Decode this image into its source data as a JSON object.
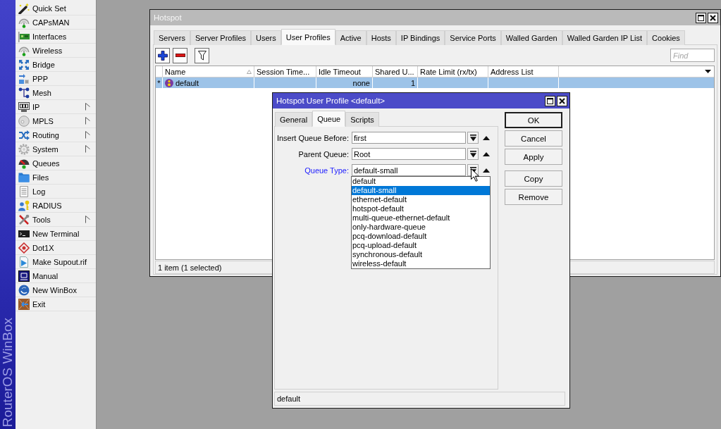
{
  "sidebar": {
    "brand": "RouterOS WinBox",
    "items": [
      {
        "label": "Quick Set",
        "submenu": false
      },
      {
        "label": "CAPsMAN",
        "submenu": false
      },
      {
        "label": "Interfaces",
        "submenu": false
      },
      {
        "label": "Wireless",
        "submenu": false
      },
      {
        "label": "Bridge",
        "submenu": false
      },
      {
        "label": "PPP",
        "submenu": false
      },
      {
        "label": "Mesh",
        "submenu": false
      },
      {
        "label": "IP",
        "submenu": true
      },
      {
        "label": "MPLS",
        "submenu": true
      },
      {
        "label": "Routing",
        "submenu": true
      },
      {
        "label": "System",
        "submenu": true
      },
      {
        "label": "Queues",
        "submenu": false
      },
      {
        "label": "Files",
        "submenu": false
      },
      {
        "label": "Log",
        "submenu": false
      },
      {
        "label": "RADIUS",
        "submenu": false
      },
      {
        "label": "Tools",
        "submenu": true
      },
      {
        "label": "New Terminal",
        "submenu": false
      },
      {
        "label": "Dot1X",
        "submenu": false
      },
      {
        "label": "Make Supout.rif",
        "submenu": false
      },
      {
        "label": "Manual",
        "submenu": false
      },
      {
        "label": "New WinBox",
        "submenu": false
      },
      {
        "label": "Exit",
        "submenu": false
      }
    ]
  },
  "hotspot_window": {
    "title": "Hotspot",
    "active": false,
    "tabs": [
      {
        "label": "Servers",
        "selected": false
      },
      {
        "label": "Server Profiles",
        "selected": false
      },
      {
        "label": "Users",
        "selected": false
      },
      {
        "label": "User Profiles",
        "selected": true
      },
      {
        "label": "Active",
        "selected": false
      },
      {
        "label": "Hosts",
        "selected": false
      },
      {
        "label": "IP Bindings",
        "selected": false
      },
      {
        "label": "Service Ports",
        "selected": false
      },
      {
        "label": "Walled Garden",
        "selected": false
      },
      {
        "label": "Walled Garden IP List",
        "selected": false
      },
      {
        "label": "Cookies",
        "selected": false
      }
    ],
    "find": {
      "placeholder": "Find"
    },
    "table": {
      "columns": [
        {
          "label": "Name",
          "kind": "text",
          "sorted": true
        },
        {
          "label": "Session Time...",
          "kind": "text",
          "sorted": false
        },
        {
          "label": "Idle Timeout",
          "kind": "numeric",
          "sorted": false
        },
        {
          "label": "Shared U...",
          "kind": "numeric",
          "sorted": false
        },
        {
          "label": "Rate Limit (rx/tx)",
          "kind": "text",
          "sorted": false
        },
        {
          "label": "Address List",
          "kind": "text",
          "sorted": false
        }
      ],
      "rows": [
        {
          "marker": "*",
          "selected": true,
          "cells": [
            "default",
            null,
            "none",
            "1",
            null,
            null
          ]
        }
      ]
    },
    "status_bar": "1 item (1 selected)"
  },
  "dialog": {
    "title": "Hotspot User Profile <default>",
    "active": true,
    "tabs": [
      {
        "label": "General",
        "selected": false
      },
      {
        "label": "Queue",
        "selected": true
      },
      {
        "label": "Scripts",
        "selected": false
      }
    ],
    "fields": [
      {
        "label": "Insert Queue Before:",
        "value": "first",
        "highlighted": false
      },
      {
        "label": "Parent Queue:",
        "value": "Root",
        "highlighted": false
      },
      {
        "label": "Queue Type:",
        "value": "default-small",
        "highlighted": true,
        "options": [
          {
            "label": "default",
            "selected": false
          },
          {
            "label": "default-small",
            "selected": true
          },
          {
            "label": "ethernet-default",
            "selected": false
          },
          {
            "label": "hotspot-default",
            "selected": false
          },
          {
            "label": "multi-queue-ethernet-default",
            "selected": false
          },
          {
            "label": "only-hardware-queue",
            "selected": false
          },
          {
            "label": "pcq-download-default",
            "selected": false
          },
          {
            "label": "pcq-upload-default",
            "selected": false
          },
          {
            "label": "synchronous-default",
            "selected": false
          },
          {
            "label": "wireless-default",
            "selected": false
          }
        ]
      }
    ],
    "button_groups": [
      [
        {
          "label": "OK",
          "default": true
        },
        {
          "label": "Cancel",
          "default": false
        },
        {
          "label": "Apply",
          "default": false
        }
      ],
      [
        {
          "label": "Copy",
          "default": false
        },
        {
          "label": "Remove",
          "default": false
        }
      ]
    ],
    "status_bar": "default"
  }
}
